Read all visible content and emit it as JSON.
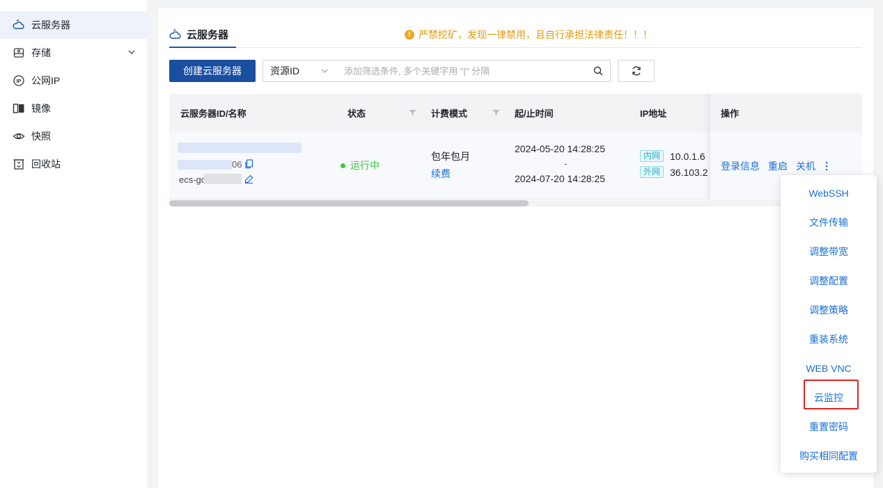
{
  "sidebar": {
    "items": [
      {
        "label": "云服务器",
        "icon": "cloud-server-icon",
        "active": true
      },
      {
        "label": "存储",
        "icon": "storage-icon",
        "expandable": true
      },
      {
        "label": "公网IP",
        "icon": "ip-icon"
      },
      {
        "label": "镜像",
        "icon": "image-icon"
      },
      {
        "label": "快照",
        "icon": "snapshot-icon"
      },
      {
        "label": "回收站",
        "icon": "recycle-bin-icon"
      }
    ]
  },
  "header": {
    "tab_label": "云服务器",
    "notice": "严禁挖矿，发现一律禁用，且自行承担法律责任！！！"
  },
  "toolbar": {
    "create_label": "创建云服务器",
    "filter_field": "资源ID",
    "search_placeholder": "添加筛选条件, 多个关键字用 \"|\" 分隔"
  },
  "table": {
    "columns": [
      "云服务器ID/名称",
      "状态",
      "计费模式",
      "起/止时间",
      "IP地址",
      "操作"
    ],
    "row": {
      "id_suffix": "06",
      "name_prefix": "ecs-gc",
      "status": "运行中",
      "billing": "包年包月",
      "renew_label": "续费",
      "start_time": "2024-05-20 14:28:25",
      "time_sep": "-",
      "end_time": "2024-07-20 14:28:25",
      "ip_inner_tag": "内网",
      "ip_inner": "10.0.1.6",
      "ip_outer_tag": "外网",
      "ip_outer": "36.103.2",
      "actions": [
        "登录信息",
        "重启",
        "关机"
      ]
    }
  },
  "dropdown": {
    "items": [
      "WebSSH",
      "文件传输",
      "调整带宽",
      "调整配置",
      "调整策略",
      "重装系统",
      "WEB VNC",
      "云监控",
      "重置密码",
      "购买相同配置"
    ],
    "highlighted": "云监控"
  },
  "colors": {
    "primary": "#1a4fa0",
    "link": "#1a6fd6",
    "warning": "#e39a0b",
    "running": "#3bc73b",
    "highlight_border": "#e02020"
  }
}
